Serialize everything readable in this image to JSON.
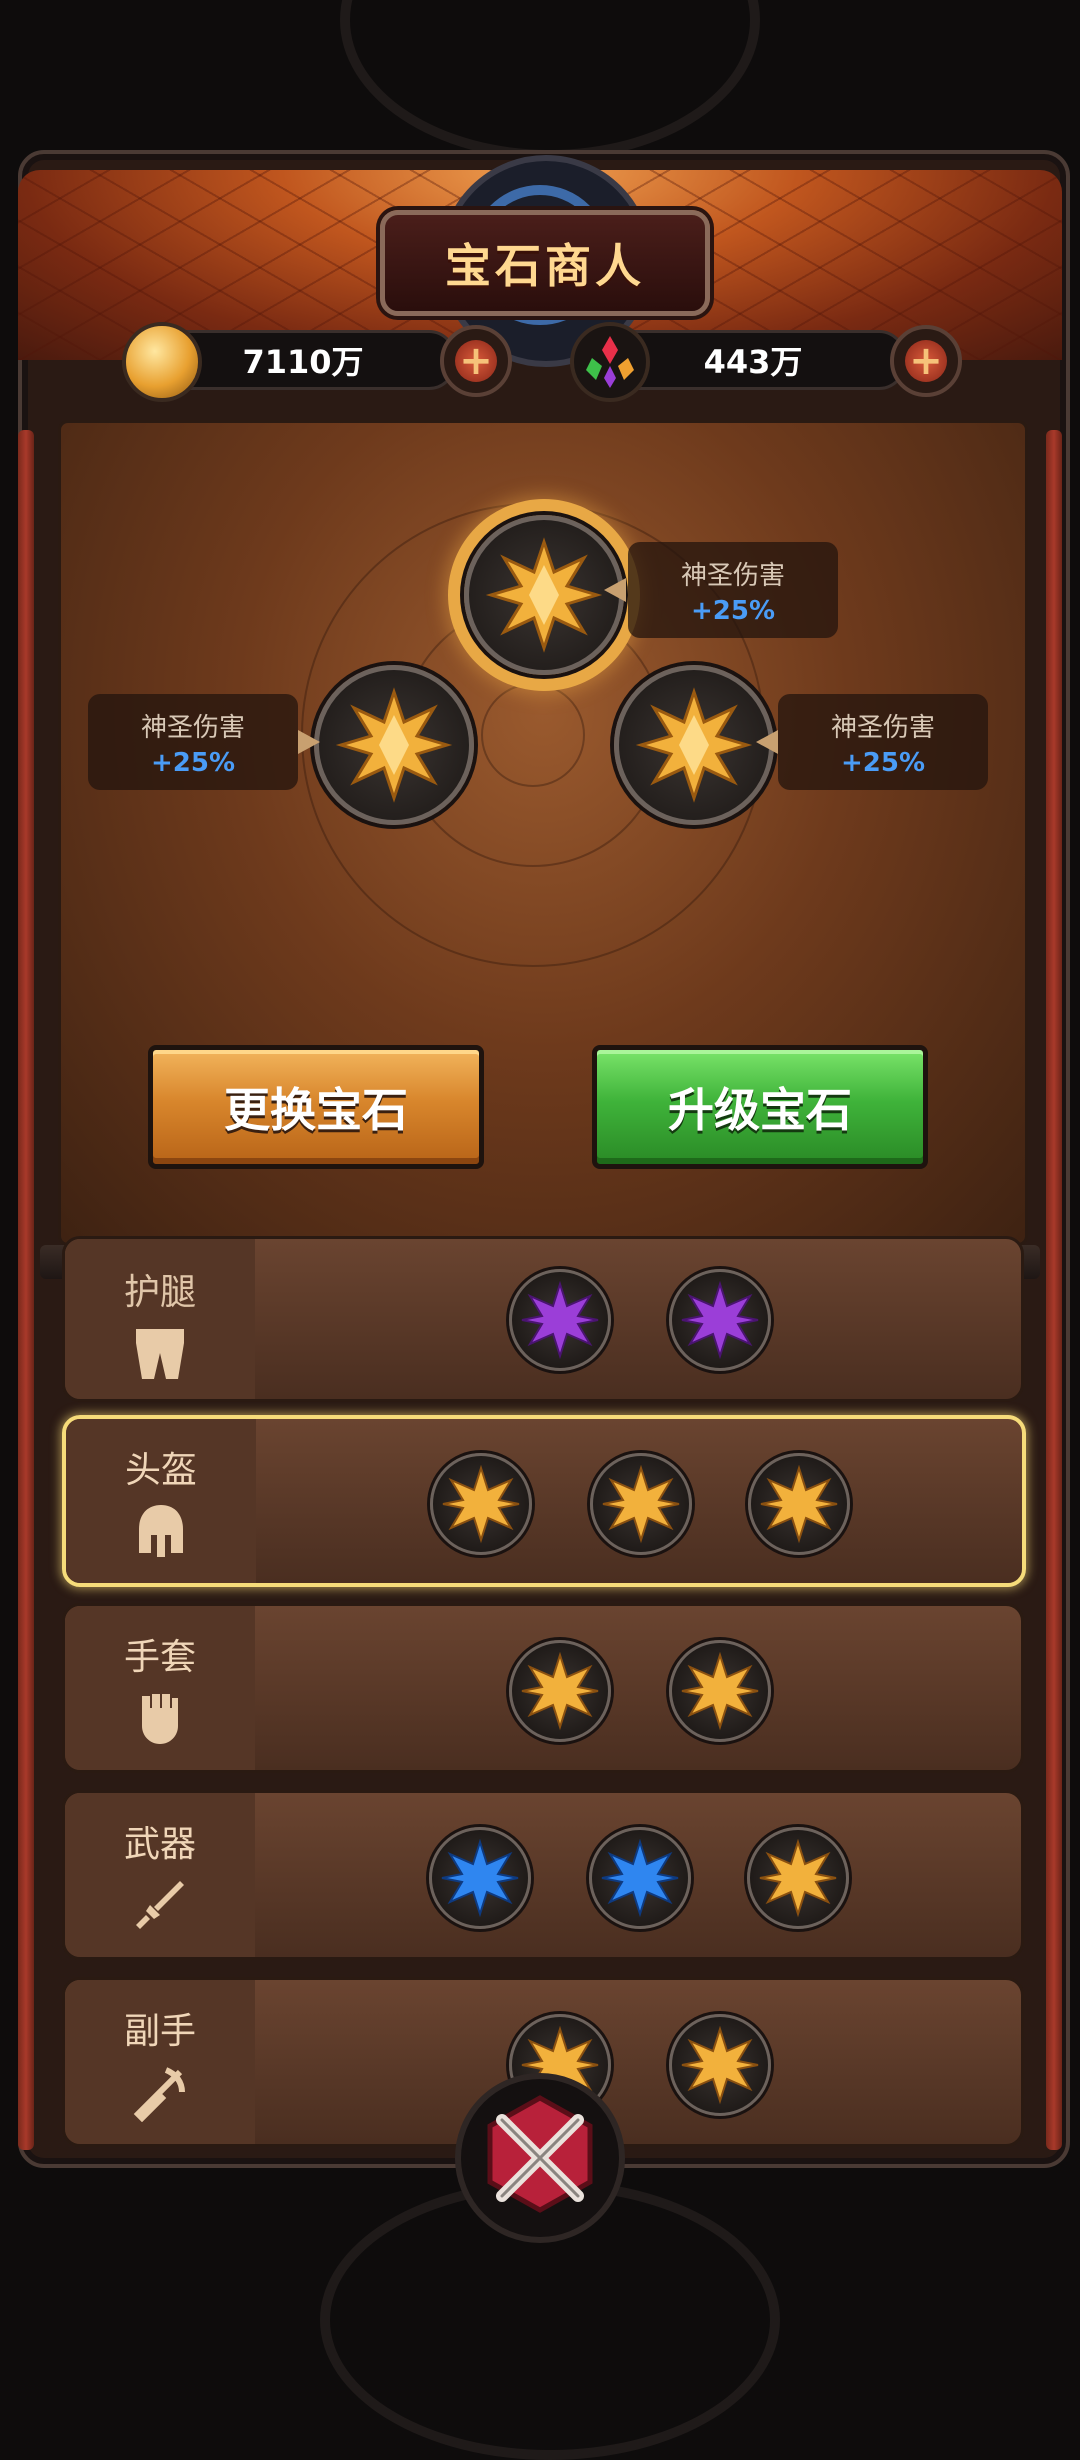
{
  "header": {
    "title": "宝石商人",
    "gold": "7110万",
    "gems": "443万"
  },
  "socket_panel": {
    "tooltips": [
      {
        "name": "神圣伤害",
        "value": "+25%"
      },
      {
        "name": "神圣伤害",
        "value": "+25%"
      },
      {
        "name": "神圣伤害",
        "value": "+25%"
      }
    ],
    "swap_button": "更换宝石",
    "upgrade_button": "升级宝石"
  },
  "equipment_rows": [
    {
      "label": "护腿",
      "icon": "leg-armor-icon",
      "gems": [
        "purple",
        "purple"
      ],
      "selected": false
    },
    {
      "label": "头盔",
      "icon": "helmet-icon",
      "gems": [
        "gold",
        "gold",
        "gold"
      ],
      "selected": true
    },
    {
      "label": "手套",
      "icon": "glove-icon",
      "gems": [
        "gold",
        "gold"
      ],
      "selected": false
    },
    {
      "label": "武器",
      "icon": "sword-icon",
      "gems": [
        "blue",
        "blue",
        "gold"
      ],
      "selected": false
    },
    {
      "label": "副手",
      "icon": "offhand-icon",
      "gems": [
        "gold",
        "gold"
      ],
      "selected": false
    }
  ],
  "colors": {
    "gold_gem": "#f2b13c",
    "purple_gem": "#9b3ed8",
    "blue_gem": "#2f86f0",
    "stat_value": "#4a9cf6"
  }
}
